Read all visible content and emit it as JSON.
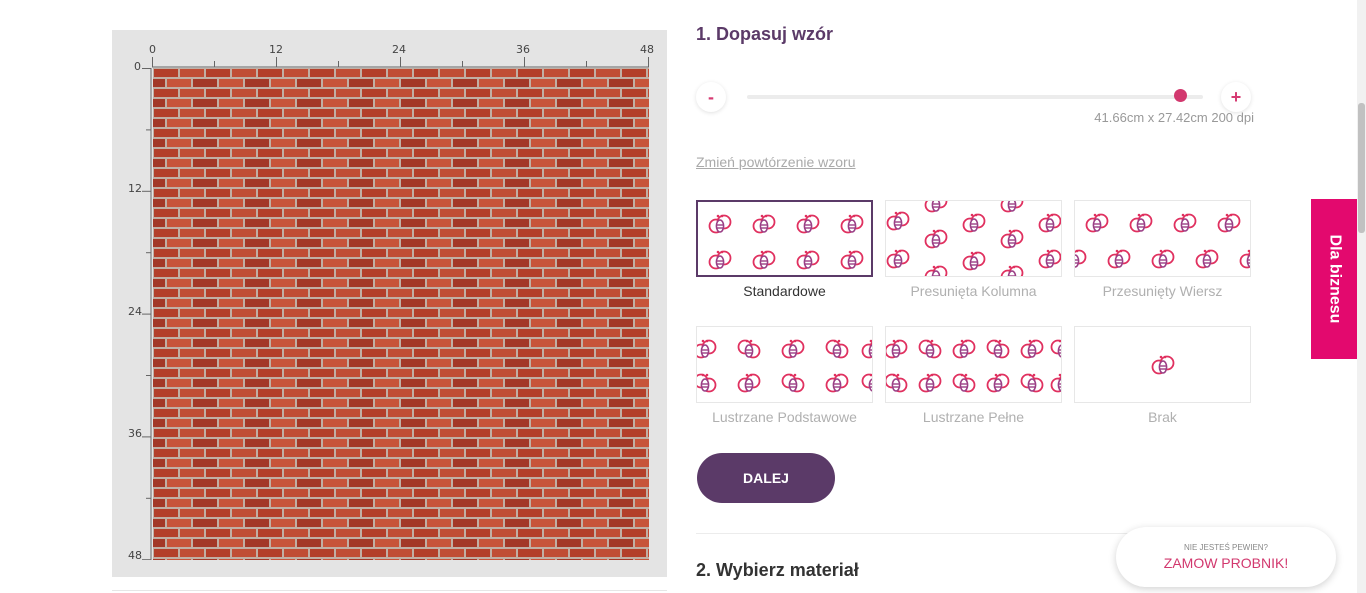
{
  "preview": {
    "ruler_top": [
      "0",
      "12",
      "24",
      "36",
      "48"
    ],
    "ruler_left": [
      "0",
      "12",
      "24",
      "36",
      "48"
    ]
  },
  "section1": {
    "title": "1. Dopasuj wzór",
    "minus_label": "-",
    "plus_label": "+",
    "slider_value": 0.95,
    "dimensions": "41.66cm x 27.42cm 200 dpi",
    "change_repeat_link": "Zmień powtórzenie wzoru",
    "repeat_options": [
      {
        "label": "Standardowe",
        "selected": true
      },
      {
        "label": "Presunięta Kolumna",
        "selected": false
      },
      {
        "label": "Przesunięty Wiersz",
        "selected": false
      },
      {
        "label": "Lustrzane Podstawowe",
        "selected": false
      },
      {
        "label": "Lustrzane Pełne",
        "selected": false
      },
      {
        "label": "Brak",
        "selected": false
      }
    ],
    "next_button": "DALEJ"
  },
  "section2": {
    "title": "2. Wybierz materiał"
  },
  "side_tab": "Dla biznesu",
  "sample_bubble": {
    "small": "NIE JESTEŚ PEWIEN?",
    "big": "ZAMOW PROBNIK!"
  },
  "colors": {
    "accent": "#5b3a68",
    "pink": "#d2386e",
    "business_tab": "#e3096e",
    "brick": "#b8452f"
  },
  "icons": [
    "bee-icon"
  ]
}
